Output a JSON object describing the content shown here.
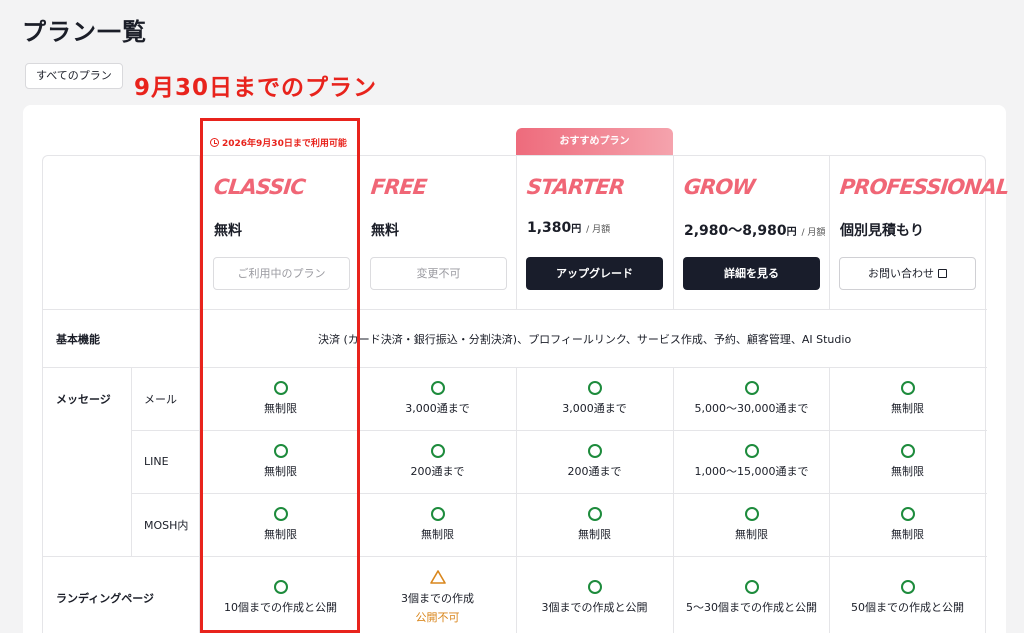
{
  "page": {
    "title": "プラン一覧"
  },
  "tabs": {
    "all": "すべてのプラン"
  },
  "annotation": "9月30日までのプラン",
  "availability_note": "2026年9月30日まで利用可能",
  "recommend_badge": "おすすめプラン",
  "plans": [
    {
      "name": "CLASSIC",
      "price": "無料",
      "unit": "",
      "per": "",
      "button": "ご利用中のプラン"
    },
    {
      "name": "FREE",
      "price": "無料",
      "unit": "",
      "per": "",
      "button": "変更不可"
    },
    {
      "name": "STARTER",
      "price": "1,380",
      "unit": "円",
      "per": "/ 月額",
      "button": "アップグレード"
    },
    {
      "name": "GROW",
      "price": "2,980〜8,980",
      "unit": "円",
      "per": "/ 月額",
      "button": "詳細を見る"
    },
    {
      "name": "PROFESSIONAL",
      "price": "個別見積もり",
      "unit": "",
      "per": "",
      "button": "お問い合わせ"
    }
  ],
  "rows": {
    "basic": {
      "label": "基本機能",
      "text": "決済 (カード決済・銀行振込・分割決済)、プロフィールリンク、サービス作成、予約、顧客管理、AI Studio"
    },
    "message": {
      "label": "メッセージ",
      "mail": {
        "label": "メール",
        "values": [
          "無制限",
          "3,000通まで",
          "3,000通まで",
          "5,000〜30,000通まで",
          "無制限"
        ]
      },
      "line": {
        "label": "LINE",
        "values": [
          "無制限",
          "200通まで",
          "200通まで",
          "1,000〜15,000通まで",
          "無制限"
        ]
      },
      "mosh": {
        "label": "MOSH内",
        "values": [
          "無制限",
          "無制限",
          "無制限",
          "無制限",
          "無制限"
        ]
      }
    },
    "landing": {
      "label": "ランディングページ",
      "values": [
        "10個までの作成と公開",
        "3個までの作成",
        "3個までの作成と公開",
        "5〜30個までの作成と公開",
        "50個までの作成と公開"
      ],
      "free_note": "公開不可"
    }
  },
  "colors": {
    "accent": "#f06676",
    "highlight": "#e8231c",
    "check": "#1d8b3c",
    "warn": "#d9861c"
  }
}
